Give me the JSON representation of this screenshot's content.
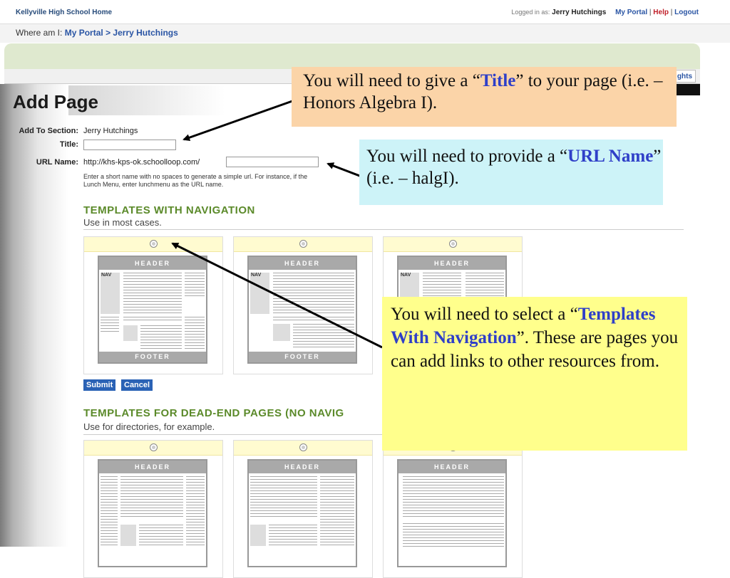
{
  "topbar": {
    "site_link": "Kellyville High School Home",
    "logged_in_label": "Logged in as:",
    "user_name": "Jerry Hutchings",
    "my_portal": "My Portal",
    "help": "Help",
    "logout": "Logout",
    "separator": "|"
  },
  "breadcrumb": {
    "label": "Where am I:",
    "items": [
      "My Portal",
      "Jerry Hutchings"
    ],
    "separator": ">"
  },
  "tab_fragment": "ghts",
  "page": {
    "title": "Add Page",
    "section_label": "Add To Section:",
    "section_value": "Jerry Hutchings",
    "title_label": "Title:",
    "title_value": "",
    "url_label": "URL Name:",
    "url_prefix": "http://khs-kps-ok.schoolloop.com/",
    "url_value": "",
    "help_text_line1": "Enter a short name with no spaces to generate a simple url. For instance, if the",
    "help_text_line2": "Lunch Menu, enter lunchmenu as the URL name."
  },
  "templates_nav": {
    "title": "TEMPLATES WITH NAVIGATION",
    "subtitle": "Use in most cases.",
    "header_label": "HEADER",
    "footer_label": "FOOTER",
    "nav_label": "NAV"
  },
  "buttons": {
    "submit": "Submit",
    "cancel": "Cancel"
  },
  "templates_deadend": {
    "title": "TEMPLATES FOR DEAD-END PAGES (NO NAVIG",
    "subtitle": "Use for directories, for example.",
    "header_label": "HEADER"
  },
  "callouts": {
    "title_callout": {
      "pre": "You will need to give a “",
      "keyword": "Title",
      "post": "” to your page (i.e. – Honors Algebra I)."
    },
    "url_callout": {
      "pre": "You will need to provide a “",
      "keyword": "URL Name",
      "post": "”  (i.e. – halgI)."
    },
    "template_callout": {
      "pre": "You will need to select a “",
      "keyword": "Templates With Navigation",
      "post": "”.  These are pages you can add links to other resources from."
    }
  },
  "colors": {
    "callout_title_bg": "#fbd4a8",
    "callout_url_bg": "#cdf3f8",
    "callout_template_bg": "#ffff8c",
    "keyword": "#2f3fc8",
    "section_heading": "#5b8a2a",
    "button": "#2a62b5"
  }
}
